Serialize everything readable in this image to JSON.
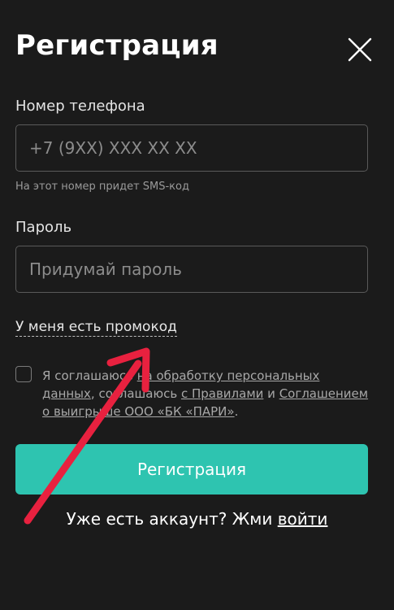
{
  "header": {
    "title": "Регистрация"
  },
  "phone": {
    "label": "Номер телефона",
    "placeholder": "+7 (9XX) XXX XX XX",
    "value": "",
    "hint": "На этот номер придет SMS-код"
  },
  "password": {
    "label": "Пароль",
    "placeholder": "Придумай пароль",
    "value": ""
  },
  "promo": {
    "link_label": "У меня есть промокод"
  },
  "consent": {
    "checked": false,
    "text_1": "Я соглашаюсь ",
    "link_processing": "на обработку персональных данных",
    "text_2": ", соглашаюсь ",
    "link_rules": "с Правилами",
    "text_3": " и ",
    "link_agreement": "Соглашением о выигрыше ООО «БК «ПАРИ»",
    "text_4": "."
  },
  "submit": {
    "label": "Регистрация"
  },
  "login": {
    "prompt": "Уже есть аккаунт? Жми ",
    "link_label": "войти"
  },
  "colors": {
    "background": "#1b1b1b",
    "accent": "#2ec4b0",
    "annotation_arrow": "#e8213f"
  },
  "icons": {
    "close": "close-icon",
    "annotation": "red-arrow-annotation"
  }
}
